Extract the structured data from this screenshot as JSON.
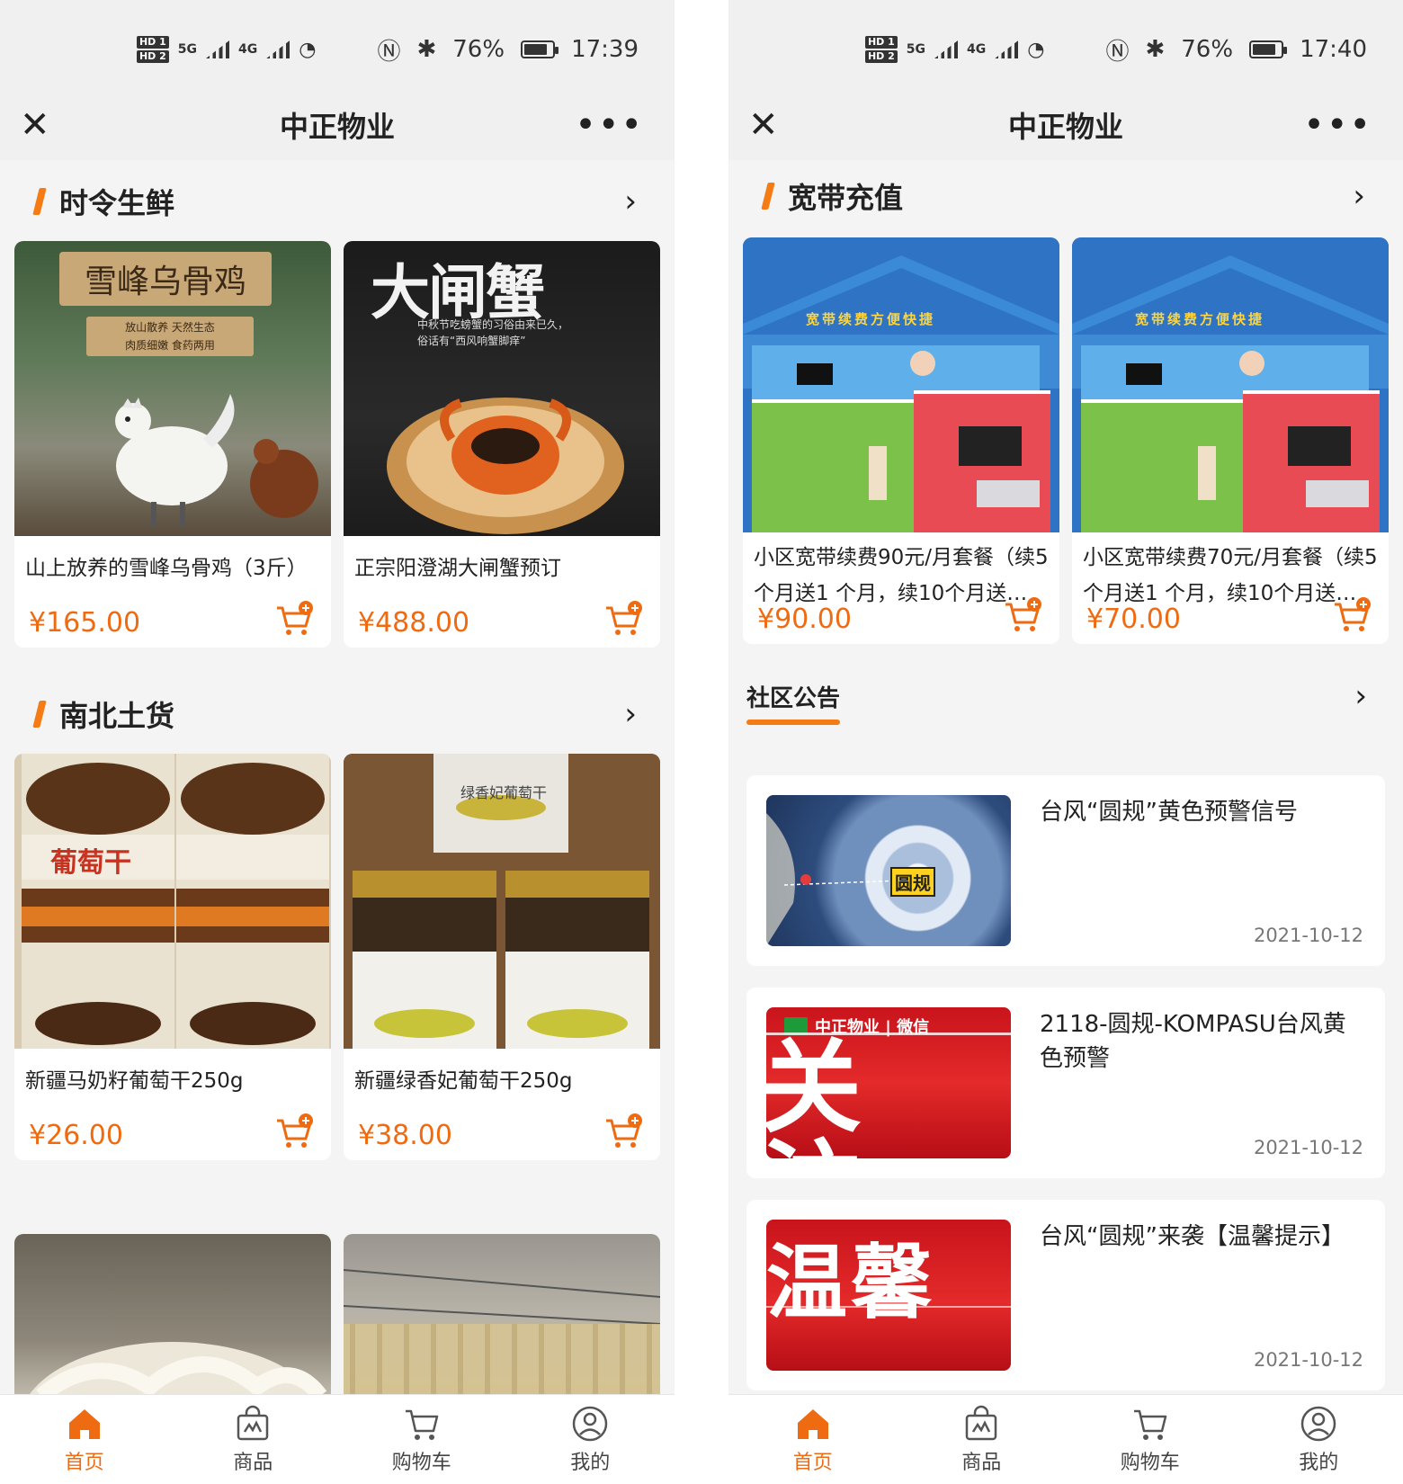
{
  "left": {
    "status": {
      "battery": "76%",
      "time": "17:39",
      "net1": "5G",
      "net2": "4G",
      "hd1": "HD 1",
      "hd2": "HD 2"
    },
    "title": "中正物业",
    "sections": [
      {
        "title": "时令生鲜",
        "products": [
          {
            "name": "山上放养的雪峰乌骨鸡（3斤）",
            "price": "¥165.00",
            "image_text": "雪峰乌骨鸡",
            "image_sub1": "放山散养 天然生态",
            "image_sub2": "肉质细嫩 食药两用"
          },
          {
            "name": "正宗阳澄湖大闸蟹预订",
            "price": "¥488.00",
            "image_text": "大闸蟹",
            "image_sub1": "中秋节吃螃蟹的习俗由来已久，",
            "image_sub2": "俗话有“西风响蟹脚痒”"
          }
        ]
      },
      {
        "title": "南北土货",
        "products": [
          {
            "name": "新疆马奶籽葡萄干250g",
            "price": "¥26.00",
            "image_text": "葡萄干"
          },
          {
            "name": "新疆绿香妃葡萄干250g",
            "price": "¥38.00",
            "image_text": "绿香妃葡萄干"
          }
        ]
      }
    ]
  },
  "right": {
    "status": {
      "battery": "76%",
      "time": "17:40",
      "net1": "5G",
      "net2": "4G",
      "hd1": "HD 1",
      "hd2": "HD 2"
    },
    "title": "中正物业",
    "broadband": {
      "title": "宽带充值",
      "banner_text": "宽带续费方便快捷",
      "products": [
        {
          "name": "小区宽带续费90元/月套餐（续5个月送1 个月，续10个月送…",
          "price": "¥90.00"
        },
        {
          "name": "小区宽带续费70元/月套餐（续5个月送1 个月，续10个月送…",
          "price": "¥70.00"
        }
      ]
    },
    "notices": {
      "title": "社区公告",
      "items": [
        {
          "title": "台风“圆规”黄色预警信号",
          "date": "2021-10-12",
          "thumb_label": "圆规"
        },
        {
          "title": "2118-圆规-KOMPASU台风黄色预警",
          "date": "2021-10-12",
          "thumb_brand": "中正物业 | 微信",
          "thumb_big": "关注"
        },
        {
          "title": "台风“圆规”来袭【温馨提示】",
          "date": "2021-10-12",
          "thumb_big": "温馨"
        }
      ]
    }
  },
  "tabbar": [
    {
      "label": "首页",
      "icon": "home-icon",
      "active": true
    },
    {
      "label": "商品",
      "icon": "shop-bag-icon",
      "active": false
    },
    {
      "label": "购物车",
      "icon": "cart-icon",
      "active": false
    },
    {
      "label": "我的",
      "icon": "user-icon",
      "active": false
    }
  ],
  "colors": {
    "accent": "#ef6b12",
    "section_bar": "#f57c14",
    "background": "#f4f4f4"
  }
}
